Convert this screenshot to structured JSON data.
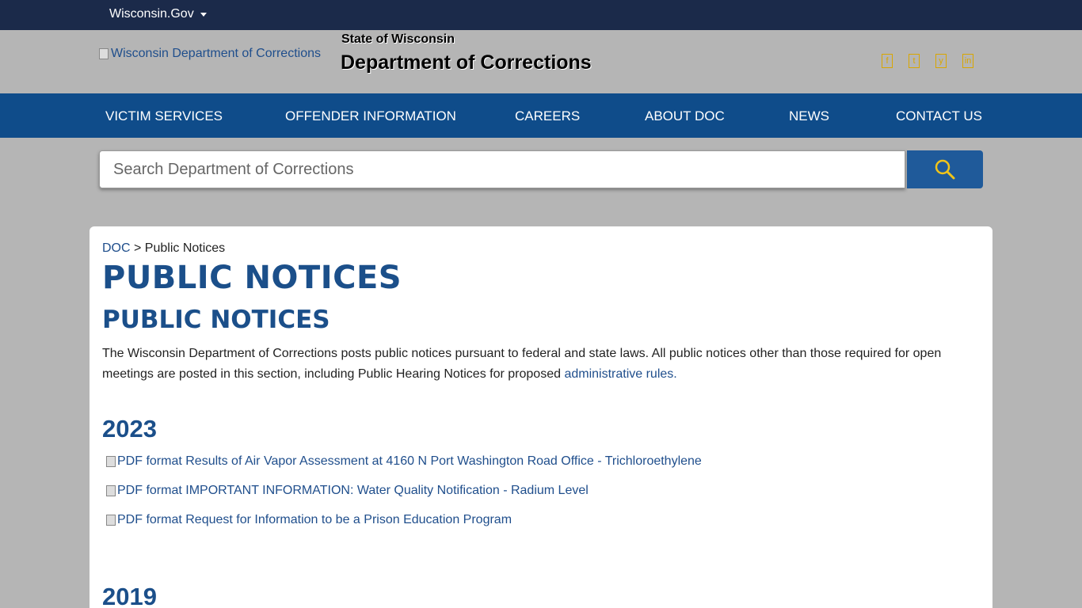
{
  "topbar": {
    "wisconsin_gov": "Wisconsin.Gov"
  },
  "header": {
    "logo_alt": "Wisconsin Department of Corrections",
    "state": "State of Wisconsin",
    "department": "Department of Corrections",
    "social_icons": [
      "facebook-icon",
      "twitter-icon",
      "youtube-icon",
      "linkedin-icon"
    ]
  },
  "nav": {
    "items": [
      "VICTIM SERVICES",
      "OFFENDER INFORMATION",
      "CAREERS",
      "ABOUT DOC",
      "NEWS",
      "CONTACT US"
    ]
  },
  "search": {
    "placeholder": "Search Department of Corrections"
  },
  "breadcrumb": {
    "root": "DOC",
    "separator": " > ",
    "current": "Public Notices"
  },
  "page": {
    "title": "PUBLIC NOTICES",
    "subtitle": "PUBLIC NOTICES",
    "intro_text": "The Wisconsin Department of Corrections posts public notices pursuant to federal and state laws. All public notices other than those required for open meetings are posted in this section, including Public Hearing Notices for proposed ",
    "intro_link": "administrative rules."
  },
  "sections": [
    {
      "year": "2023",
      "notices": [
        {
          "icon_alt": "PDF format",
          "label": "Results of Air Vapor Assessment at 4160 N Port Washington Road Office - Trichloroethylene"
        },
        {
          "icon_alt": "PDF format",
          "label": "IMPORTANT INFORMATION: Water Quality Notification - Radium Level"
        },
        {
          "icon_alt": "PDF format",
          "label": "Request for Information to be a Prison Education Program"
        }
      ]
    },
    {
      "year": "2019"
    }
  ],
  "colors": {
    "topbar": "#1b2a4a",
    "nav": "#0f4c8a",
    "heading": "#1b4f8a",
    "link": "#1f4e8c",
    "search_icon": "#f0c419"
  }
}
